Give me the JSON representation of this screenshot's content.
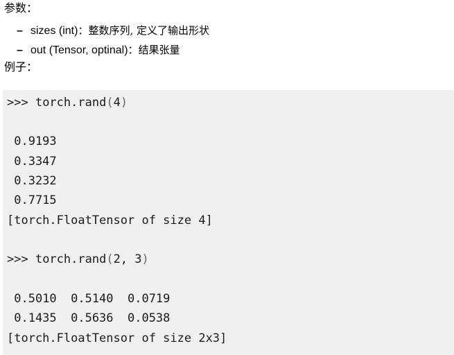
{
  "params_label": "参数：",
  "params": [
    {
      "name": "sizes (int)",
      "sep": "：",
      "desc": "整数序列, 定义了输出形状"
    },
    {
      "name": "out (Tensor, optinal)",
      "sep": "：",
      "desc": "结果张量"
    }
  ],
  "example_label": "例子：",
  "code": {
    "cmd1": {
      "prompt": ">>> ",
      "call": "torch.rand",
      "open": "(",
      "args": "4",
      "close": ")"
    },
    "out1": [
      " 0.9193",
      " 0.3347",
      " 0.3232",
      " 0.7715"
    ],
    "type1": "[torch.FloatTensor of size 4]",
    "cmd2": {
      "prompt": ">>> ",
      "call": "torch.rand",
      "open": "(",
      "args": "2, 3",
      "close": ")"
    },
    "out2": [
      " 0.5010  0.5140  0.0719",
      " 0.1435  0.5636  0.0538"
    ],
    "type2": "[torch.FloatTensor of size 2x3]"
  }
}
